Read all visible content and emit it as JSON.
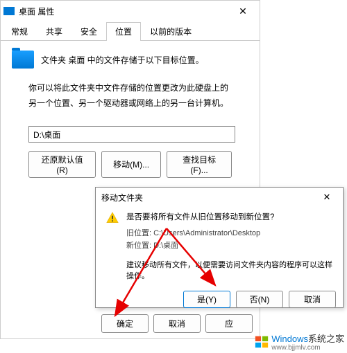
{
  "properties": {
    "title": "桌面 属性",
    "close": "✕",
    "tabs": [
      "常规",
      "共享",
      "安全",
      "位置",
      "以前的版本"
    ],
    "active_tab": 3,
    "folder_desc": "文件夹 桌面 中的文件存储于以下目标位置。",
    "long_desc": "你可以将此文件夹中文件存储的位置更改为此硬盘上的另一个位置、另一个驱动器或网络上的另一台计算机。",
    "path_value": "D:\\桌面",
    "btn_restore": "还原默认值(R)",
    "btn_move": "移动(M)...",
    "btn_find": "查找目标(F)...",
    "btn_ok": "确定",
    "btn_cancel": "取消",
    "btn_apply": "应"
  },
  "move_dialog": {
    "title": "移动文件夹",
    "close": "✕",
    "question": "是否要将所有文件从旧位置移动到新位置?",
    "old_path_label": "旧位置: ",
    "old_path": "C:\\Users\\Administrator\\Desktop",
    "new_path_label": "新位置: ",
    "new_path": "D:\\桌面",
    "note": "建议移动所有文件，以便需要访问文件夹内容的程序可以这样操作。",
    "btn_yes": "是(Y)",
    "btn_no": "否(N)",
    "btn_cancel": "取消"
  },
  "watermark": {
    "main_text": "Windows",
    "sub_text1": "系统之家",
    "sub_text2": "www.bjjmlv.com"
  }
}
